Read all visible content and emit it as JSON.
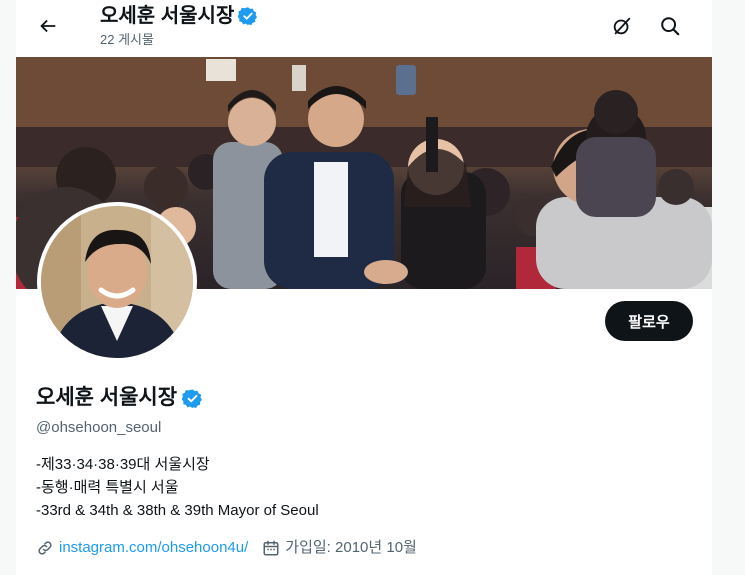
{
  "header": {
    "name": "오세훈 서울시장",
    "post_count": "22 게시물"
  },
  "icons": {
    "back": "arrow-left-icon",
    "verified": "verified-badge-icon",
    "grok": "grok-slash-circle-icon",
    "search": "search-icon",
    "link": "link-icon",
    "calendar": "calendar-icon"
  },
  "colors": {
    "verified": "#1d9bf0",
    "link": "#1d9bf0",
    "follow_bg": "#0f1419",
    "muted": "#536471"
  },
  "profile": {
    "follow_label": "팔로우",
    "name": "오세훈 서울시장",
    "handle": "@ohsehoon_seoul",
    "bio": [
      "-제33·34·38·39대 서울시장",
      "-동행·매력 특별시 서울",
      "-33rd & 34th & 38th & 39th Mayor of Seoul"
    ],
    "website": "instagram.com/ohsehoon4u/",
    "joined": "가입일: 2010년 10월"
  }
}
